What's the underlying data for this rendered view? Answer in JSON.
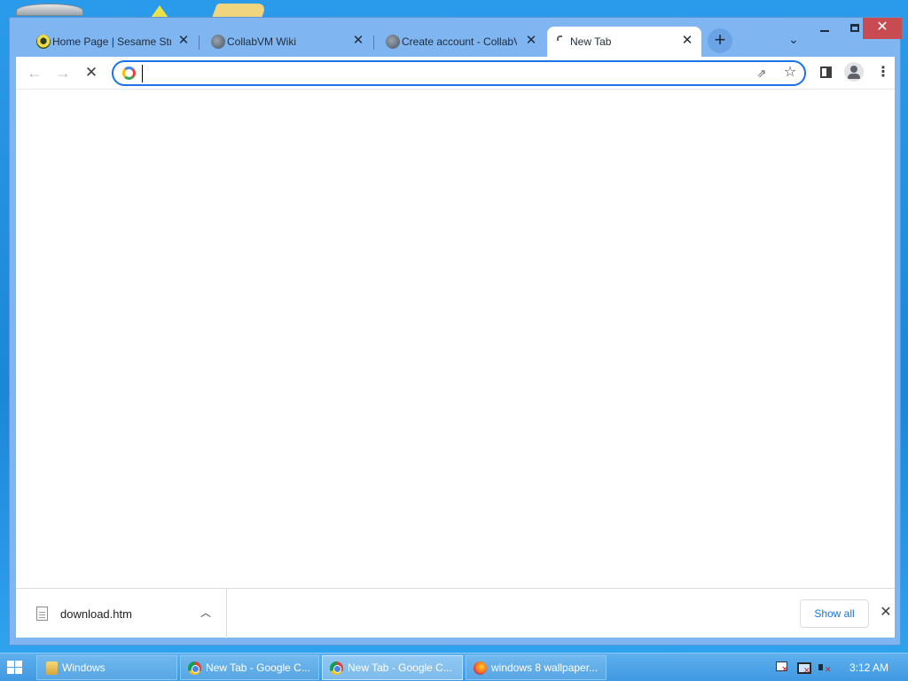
{
  "browser": {
    "tabs": [
      {
        "title": "Home Page | Sesame Street",
        "icon": "sesame-street-icon",
        "active": false
      },
      {
        "title": "CollabVM Wiki",
        "icon": "globe-icon",
        "active": false
      },
      {
        "title": "Create account - CollabVM",
        "icon": "globe-icon",
        "active": false
      },
      {
        "title": "New Tab",
        "icon": "loading-icon",
        "active": true
      }
    ],
    "new_tab_label": "+",
    "omnibox": {
      "value": "",
      "placeholder": ""
    },
    "accent_color": "#1a73e8"
  },
  "downloads": {
    "items": [
      {
        "file_name": "download.htm"
      }
    ],
    "show_all_label": "Show all"
  },
  "taskbar": {
    "buttons": [
      {
        "label": "Windows",
        "icon": "folder-icon"
      },
      {
        "label": "New Tab - Google C...",
        "icon": "chrome-icon"
      },
      {
        "label": "New Tab - Google C...",
        "icon": "chrome-icon"
      },
      {
        "label": "windows 8 wallpaper...",
        "icon": "firefox-icon"
      }
    ],
    "clock": "3:12 AM"
  }
}
